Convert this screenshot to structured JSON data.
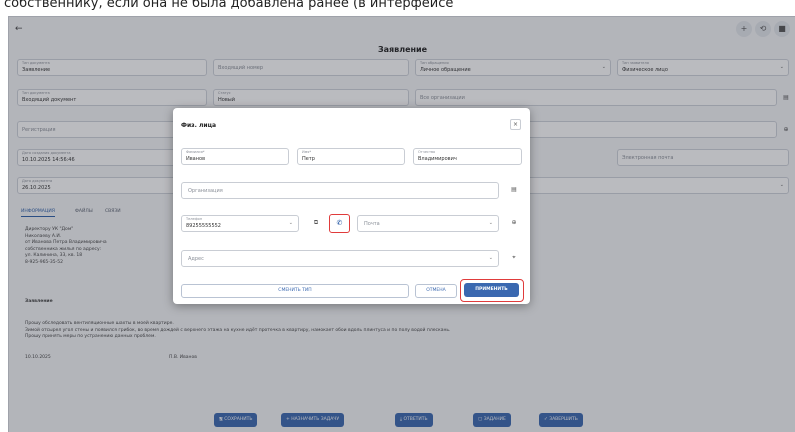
{
  "caption": "собственнику, если она не была добавлена ранее (в интерфейсе",
  "topbar": {
    "back_icon": "←",
    "icons": [
      "+",
      "⟲",
      "■"
    ]
  },
  "page": {
    "title": "Заявление"
  },
  "form": {
    "doc_type": {
      "label": "Тип документа",
      "value": "Заявление"
    },
    "incoming_number": {
      "placeholder": "Входящий номер"
    },
    "appeal_type": {
      "label": "Тип обращения",
      "value": "Личное обращение"
    },
    "applicant_type": {
      "label": "Тип заявителя",
      "value": "Физическое лицо"
    },
    "doc_subtype": {
      "label": "Тип документа",
      "value": "Входящий документ"
    },
    "status": {
      "label": "Статус",
      "value": "Новый"
    },
    "organization": {
      "placeholder": "Все организации"
    },
    "registration": {
      "placeholder": "Регистрация"
    },
    "date_created": {
      "label": "Дата создания документа",
      "value": "10.10.2025 14:56:46"
    },
    "email": {
      "placeholder": "Электронная почта"
    },
    "doc_date": {
      "label": "Дата документа",
      "value": "26.10.2025"
    }
  },
  "tabs": [
    "ИНФОРМАЦИЯ",
    "ФАЙЛЫ",
    "СВЯЗИ"
  ],
  "letter": {
    "header": [
      "Директору УК \"Дом\"",
      "Николаеву А.И.",
      "от Иванова Петра Владимировича",
      "собственника жилья по адресу:",
      "ул. Калинина, 33, кв. 18",
      "8-925-965-35-52"
    ],
    "title": "Заявление",
    "body": [
      "Прошу обследовать вентиляционные шахты в моей квартире.",
      "Зимой отсырел угол стены и появился грибок, во время дождей с верхнего этажа на кухне идёт протечка в квартиру, намокает обои вдоль плинтуса и по полу водой плескань.",
      "Прошу принять меры по устранению данных проблем."
    ],
    "date": "10.10.2025",
    "signature": "П.В. Иванов"
  },
  "bottom_buttons": [
    "СОХРАНИТЬ",
    "НАЗНАЧИТЬ ЗАДАЧУ",
    "ОТВЕТИТЬ",
    "ЗАДАНИЕ",
    "ЗАВЕРШИТЬ"
  ],
  "bottom_icons": [
    "🖫",
    "+",
    "⤓",
    "▢",
    "✓"
  ],
  "dialog": {
    "title": "Физ. лица",
    "close_icon": "×",
    "surname": {
      "label": "Фамилия*",
      "value": "Иванов"
    },
    "name": {
      "label": "Имя*",
      "value": "Петр"
    },
    "patronymic": {
      "label": "Отчество",
      "value": "Владимирович"
    },
    "organization": {
      "placeholder": "Организация"
    },
    "phone": {
      "label": "Телефон",
      "value": "89255555552"
    },
    "email": {
      "placeholder": "Почта"
    },
    "address": {
      "placeholder": "Адрес"
    },
    "change_type_label": "СМЕНИТЬ ТИП",
    "cancel_label": "ОТМЕНА",
    "apply_label": "ПРИМЕНИТЬ",
    "phone_icon": "✆",
    "copy_icon": "⧉",
    "org_icon": "▤",
    "email_icon": "⊕",
    "address_icon": "⌖"
  },
  "colors": {
    "accent": "#3a68b0",
    "highlight": "#e03b3b",
    "overlay": "rgba(40,45,55,0.32)"
  }
}
